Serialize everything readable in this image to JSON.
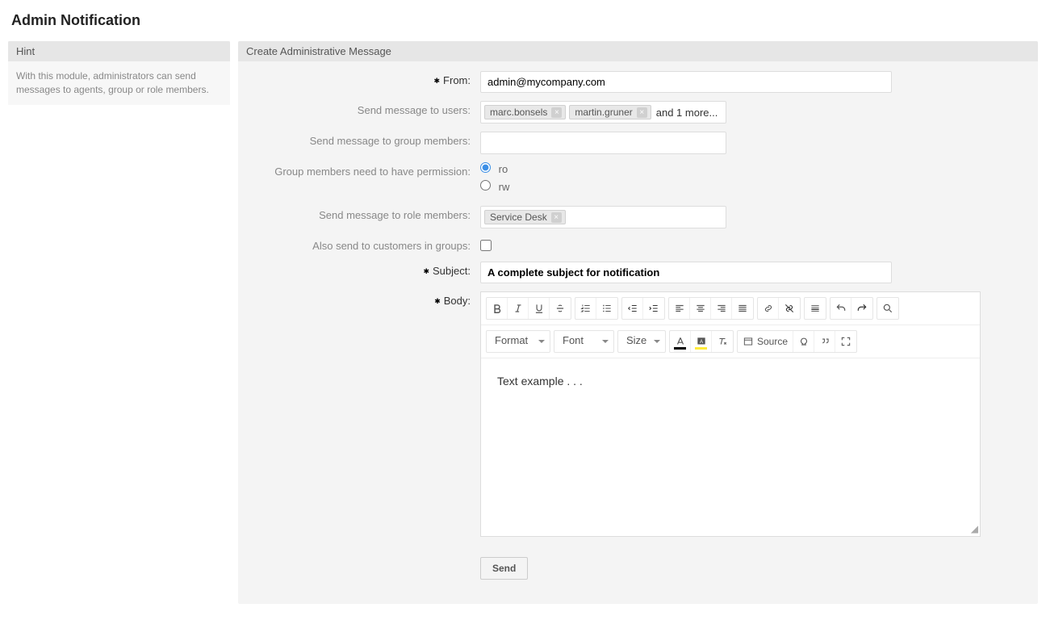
{
  "page_title": "Admin Notification",
  "sidebar": {
    "hint_header": "Hint",
    "hint_body": "With this module, administrators can send messages to agents, group or role members."
  },
  "main": {
    "header": "Create Administrative Message",
    "labels": {
      "from": "From:",
      "to_users": "Send message to users:",
      "to_groups": "Send message to group members:",
      "permission": "Group members need to have permission:",
      "to_roles": "Send message to role members:",
      "to_customers": "Also send to customers in groups:",
      "subject": "Subject:",
      "body": "Body:"
    },
    "from_value": "admin@mycompany.com",
    "users": {
      "tags": [
        "marc.bonsels",
        "martin.gruner"
      ],
      "more": "and 1 more..."
    },
    "permission_options": {
      "ro": "ro",
      "rw": "rw"
    },
    "permission_selected": "ro",
    "roles": {
      "tags": [
        "Service Desk"
      ]
    },
    "subject_value": "A complete subject for notification",
    "body_text": "Text example . . .",
    "toolbar": {
      "format": "Format",
      "font": "Font",
      "size": "Size",
      "source": "Source"
    },
    "send_label": "Send"
  }
}
